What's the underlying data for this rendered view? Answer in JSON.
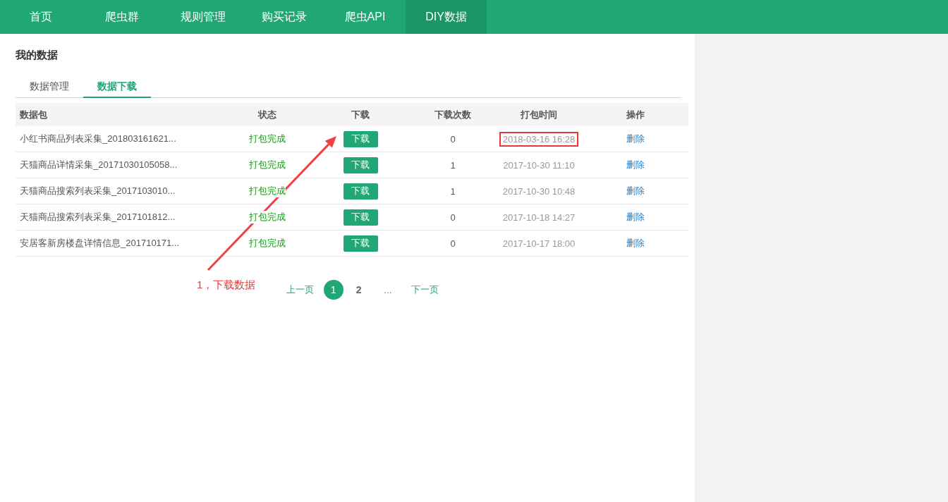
{
  "nav": [
    {
      "label": "首页",
      "selected": false
    },
    {
      "label": "爬虫群",
      "selected": false
    },
    {
      "label": "规则管理",
      "selected": false
    },
    {
      "label": "购买记录",
      "selected": false
    },
    {
      "label": "爬虫API",
      "selected": false
    },
    {
      "label": "DIY数据",
      "selected": true
    }
  ],
  "page_title": "我的数据",
  "tabs": [
    {
      "label": "数据管理",
      "selected": false
    },
    {
      "label": "数据下载",
      "selected": true
    }
  ],
  "table": {
    "columns": [
      "数据包",
      "状态",
      "下载",
      "下载次数",
      "打包时间",
      "操作"
    ],
    "rows": [
      {
        "package": "小红书商品列表采集_201803161621...",
        "status": "打包完成",
        "download": "下载",
        "count": "0",
        "time": "2018-03-16 16:28",
        "time_highlighted": true,
        "action": "删除"
      },
      {
        "package": "天猫商品详情采集_20171030105058...",
        "status": "打包完成",
        "download": "下载",
        "count": "1",
        "time": "2017-10-30 11:10",
        "time_highlighted": false,
        "action": "删除"
      },
      {
        "package": "天猫商品搜索列表采集_2017103010...",
        "status": "打包完成",
        "download": "下载",
        "count": "1",
        "time": "2017-10-30 10:48",
        "time_highlighted": false,
        "action": "删除"
      },
      {
        "package": "天猫商品搜索列表采集_2017101812...",
        "status": "打包完成",
        "download": "下载",
        "count": "0",
        "time": "2017-10-18 14:27",
        "time_highlighted": false,
        "action": "删除"
      },
      {
        "package": "安居客新房楼盘详情信息_201710171...",
        "status": "打包完成",
        "download": "下载",
        "count": "0",
        "time": "2017-10-17 18:00",
        "time_highlighted": false,
        "action": "删除"
      }
    ]
  },
  "pagination": {
    "prev": "上一页",
    "pages": [
      {
        "label": "1",
        "selected": true
      },
      {
        "label": "2",
        "selected": false
      }
    ],
    "ellipsis": "...",
    "next": "下一页"
  },
  "annotation": {
    "label": "1，下载数据"
  }
}
